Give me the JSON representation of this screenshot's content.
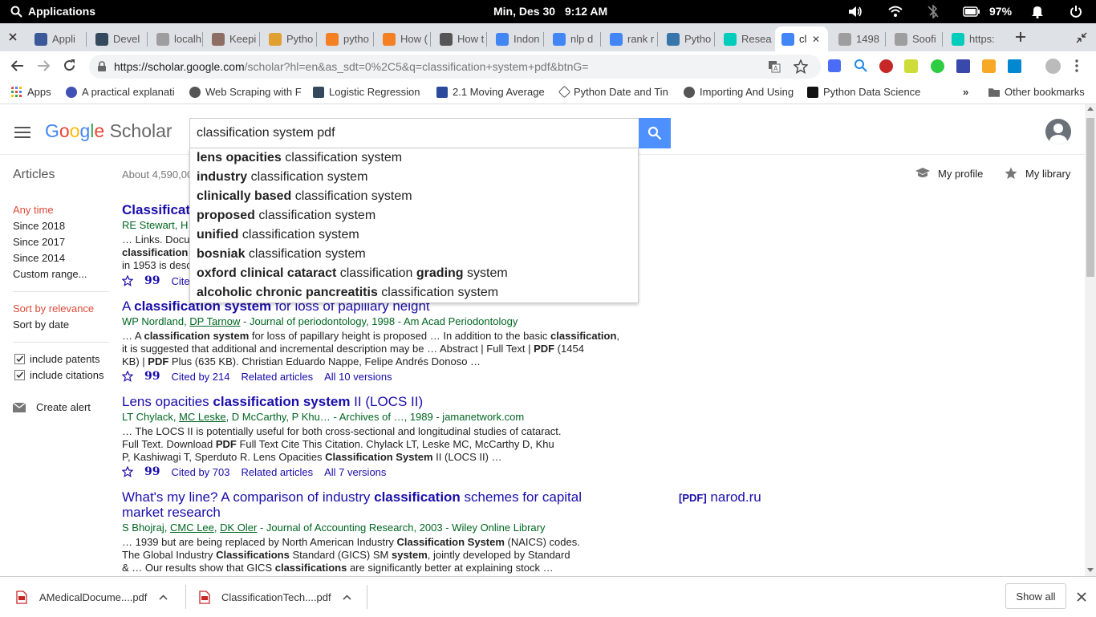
{
  "system_bar": {
    "applications_label": "Applications",
    "datetime": "Min, Des 30",
    "time": "9:12 AM",
    "battery": "97%"
  },
  "tabs": [
    {
      "label": "Appli",
      "color": "#3b5998"
    },
    {
      "label": "Devel",
      "color": "#34495e"
    },
    {
      "label": "localh",
      "color": "#9e9e9e"
    },
    {
      "label": "Keepi",
      "color": "#8d6e63"
    },
    {
      "label": "Pytho",
      "color": "#e0a030"
    },
    {
      "label": "pytho",
      "color": "#f48024"
    },
    {
      "label": "How (",
      "color": "#f48024"
    },
    {
      "label": "How t",
      "color": "#555555"
    },
    {
      "label": "Indon",
      "color": "#4285f4"
    },
    {
      "label": "nlp d",
      "color": "#4285f4"
    },
    {
      "label": "rank r",
      "color": "#4285f4"
    },
    {
      "label": "Pytho",
      "color": "#3776ab"
    },
    {
      "label": "Resea",
      "color": "#00ccbb"
    },
    {
      "label": "cl",
      "color": "#4285f4"
    },
    {
      "label": "1498",
      "color": "#9e9e9e"
    },
    {
      "label": "Soofi",
      "color": "#9e9e9e"
    },
    {
      "label": "https:",
      "color": "#00ccbb"
    }
  ],
  "address": {
    "domain": "https://scholar.google.com",
    "path": "/scholar?hl=en&as_sdt=0%2C5&q=classification+system+pdf&btnG="
  },
  "bookmarks": [
    {
      "label": "Apps"
    },
    {
      "label": "A practical explanati"
    },
    {
      "label": "Web Scraping with F"
    },
    {
      "label": "Logistic Regression"
    },
    {
      "label": "2.1 Moving Average"
    },
    {
      "label": "Python Date and Tin"
    },
    {
      "label": "Importing And Using"
    },
    {
      "label": "Python Data Science"
    },
    {
      "label": "Other bookmarks"
    }
  ],
  "header": {
    "logo": "Google Scholar",
    "search_value": "classification system pdf",
    "my_profile": "My profile",
    "my_library": "My library"
  },
  "suggestions": [
    {
      "bold": "lens opacities",
      "rest": " classification system"
    },
    {
      "bold": "industry",
      "rest": " classification system"
    },
    {
      "bold": "clinically based",
      "rest": " classification system"
    },
    {
      "bold": "proposed",
      "rest": " classification system"
    },
    {
      "bold": "unified",
      "rest": " classification system"
    },
    {
      "bold": "bosniak",
      "rest": " classification system"
    },
    {
      "bold": "oxford clinical cataract",
      "rest": " classification ",
      "bold2": "grading",
      "rest2": " system"
    },
    {
      "bold": "alcoholic chronic pancreatitis",
      "rest": " classification system"
    }
  ],
  "sidebar": {
    "articles": "Articles",
    "about": "About 4,590,00",
    "time_filters": [
      "Any time",
      "Since 2018",
      "Since 2017",
      "Since 2014",
      "Custom range..."
    ],
    "sort": [
      "Sort by relevance",
      "Sort by date"
    ],
    "include_patents": "include patents",
    "include_citations": "include citations",
    "create_alert": "Create alert"
  },
  "results": [
    {
      "title_pre": "Classificat",
      "authors": "RE Stewart, H",
      "snippet1": "… Links. Docu",
      "snippet2": "classification",
      "snippet3": "in 1953 is desc",
      "cited": "Cited"
    },
    {
      "title_pre": "A ",
      "title_bold": "classification system",
      "title_post": " for loss of papillary height",
      "authors_pre": "WP Nordland, ",
      "authors_link": "DP Tarnow",
      "authors_post": " - Journal of periodontology, 1998 - Am Acad Periodontology",
      "snippet1_a": "… A ",
      "snippet1_b": "classification system",
      "snippet1_c": " for loss of papillary height is proposed … In addition to the basic ",
      "snippet1_d": "classification",
      "snippet1_e": ",",
      "snippet2_a": "it is suggested that additional and incremental description may be … Abstract | Full Text | ",
      "snippet2_b": "PDF",
      "snippet2_c": " (1454",
      "snippet3_a": "KB) | ",
      "snippet3_b": "PDF",
      "snippet3_c": " Plus (635 KB). Christian Eduardo Nappe, Felipe Andrés Donoso …",
      "cited": "Cited by 214",
      "related": "Related articles",
      "versions": "All 10 versions"
    },
    {
      "title_pre": "Lens opacities ",
      "title_bold": "classification system",
      "title_post": " II (LOCS II)",
      "authors_pre": "LT Chylack, ",
      "authors_link": "MC Leske",
      "authors_post": ", D McCarthy, P Khu… - Archives of …, 1989 - jamanetwork.com",
      "snippet1": "… The LOCS II is potentially useful for both cross-sectional and longitudinal studies of cataract.",
      "snippet2_a": "Full Text. Download ",
      "snippet2_b": "PDF",
      "snippet2_c": " Full Text Cite This Citation. Chylack LT, Leske MC, McCarthy D, Khu",
      "snippet3_a": "P, Kashiwagi T, Sperduto R. Lens Opacities ",
      "snippet3_b": "Classification System",
      "snippet3_c": " II (LOCS II) …",
      "cited": "Cited by 703",
      "related": "Related articles",
      "versions": "All 7 versions"
    },
    {
      "title_line1_pre": "What's my line? A comparison of industry ",
      "title_line1_bold": "classification",
      "title_line1_post": " schemes for capital",
      "title_line2": "market research",
      "pdf_tag": "[PDF]",
      "pdf_source": "narod.ru",
      "authors_pre": "S Bhojraj, ",
      "authors_link1": "CMC Lee",
      "authors_mid": ", ",
      "authors_link2": "DK Oler",
      "authors_post": " - Journal of Accounting Research, 2003 - Wiley Online Library",
      "snippet1_a": "… 1939 but are being replaced by North American Industry ",
      "snippet1_b": "Classification System",
      "snippet1_c": " (NAICS) codes.",
      "snippet2_a": "The Global Industry ",
      "snippet2_b": "Classifications",
      "snippet2_c": " Standard (GICS) SM ",
      "snippet2_d": "system",
      "snippet2_e": ", jointly developed by Standard",
      "snippet3_a": "& … Our results show that GICS ",
      "snippet3_b": "classifications",
      "snippet3_c": " are significantly better at explaining stock …"
    }
  ],
  "downloads": [
    {
      "name": "AMedicalDocume....pdf"
    },
    {
      "name": "ClassificationTech....pdf"
    }
  ],
  "show_all": "Show all"
}
